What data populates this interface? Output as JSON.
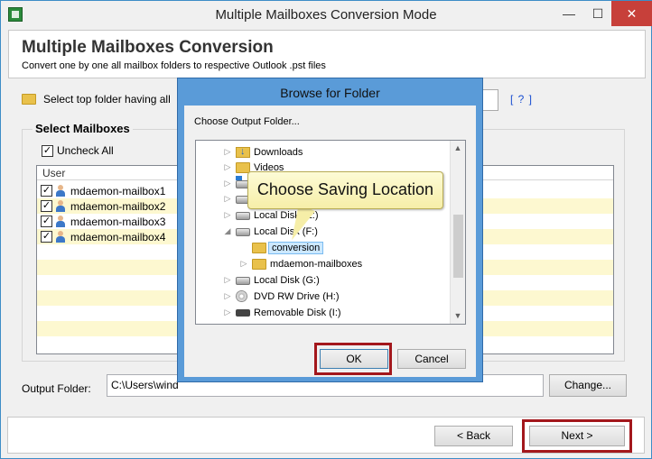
{
  "window": {
    "title": "Multiple Mailboxes Conversion Mode",
    "min_glyph": "—",
    "max_glyph": "☐",
    "close_glyph": "✕"
  },
  "header": {
    "title": "Multiple Mailboxes Conversion",
    "subtitle": "Convert one by one all mailbox folders to respective Outlook .pst files"
  },
  "top_folder": {
    "label": "Select top folder having all",
    "help_link": "[ ? ]"
  },
  "mailboxes": {
    "group_label": "Select Mailboxes",
    "uncheck_all_label": "Uncheck All",
    "column_user": "User",
    "rows": [
      {
        "name": "mdaemon-mailbox1",
        "checked": true
      },
      {
        "name": "mdaemon-mailbox2",
        "checked": true
      },
      {
        "name": "mdaemon-mailbox3",
        "checked": true
      },
      {
        "name": "mdaemon-mailbox4",
        "checked": true
      }
    ]
  },
  "output": {
    "label": "Output Folder:",
    "value": "C:\\Users\\wind",
    "change_label": "Change..."
  },
  "footer": {
    "back_label": "< Back",
    "next_label": "Next >"
  },
  "dialog": {
    "title": "Browse for Folder",
    "prompt": "Choose Output Folder...",
    "tree": [
      {
        "label": "Downloads",
        "icon": "download-folder-icon"
      },
      {
        "label": "Videos",
        "icon": "folder-icon"
      },
      {
        "label": "",
        "icon": "system-disk-icon"
      },
      {
        "label": "Local Disk (E:)",
        "icon": "disk-icon"
      },
      {
        "label": "Local Disk (F:)",
        "icon": "disk-icon"
      },
      {
        "label": "conversion",
        "icon": "folder-icon",
        "selected": true
      },
      {
        "label": "mdaemon-mailboxes",
        "icon": "folder-icon"
      },
      {
        "label": "Local Disk (G:)",
        "icon": "disk-icon"
      },
      {
        "label": "DVD RW Drive (H:)",
        "icon": "dvd-icon"
      },
      {
        "label": "Removable Disk (I:)",
        "icon": "removable-disk-icon"
      }
    ],
    "ok_label": "OK",
    "cancel_label": "Cancel"
  },
  "callout": {
    "text": "Choose Saving Location"
  },
  "colors": {
    "highlight_box": "#a3171c",
    "alt_row": "#fdf8d0",
    "dialog_frame": "#5a9bd8",
    "close_button": "#c7403a"
  }
}
